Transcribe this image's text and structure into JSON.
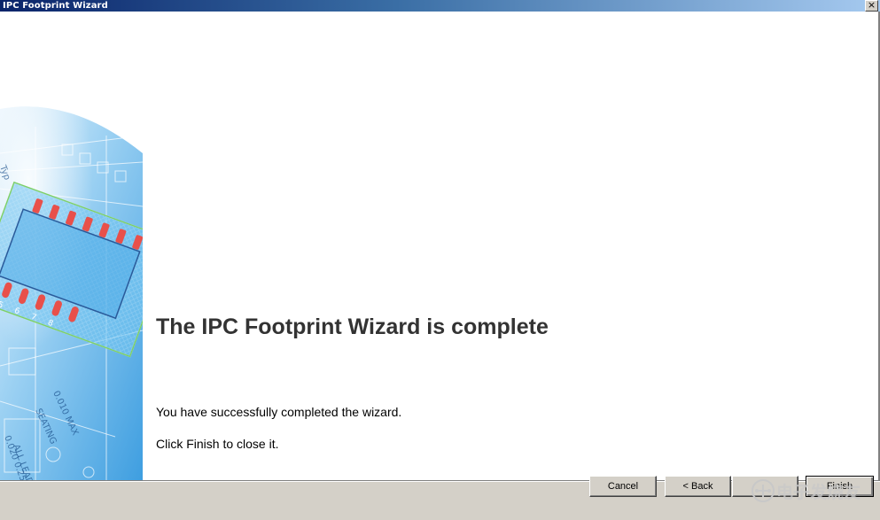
{
  "window": {
    "title": "IPC Footprint Wizard",
    "close_glyph": "×"
  },
  "main": {
    "heading": "The IPC Footprint Wizard is complete",
    "message_line1": "You have successfully completed the wizard.",
    "message_line2": "Click Finish to close it."
  },
  "buttons": {
    "cancel_label": "Cancel",
    "back_label": "< Back",
    "next_label": "",
    "finish_label": "Finish"
  },
  "watermark": {
    "text": "电子发烧友"
  },
  "colors": {
    "titlebar_start": "#0a246a",
    "titlebar_end": "#a6caf0",
    "heading": "#333333",
    "pad_red": "#e8504a"
  }
}
